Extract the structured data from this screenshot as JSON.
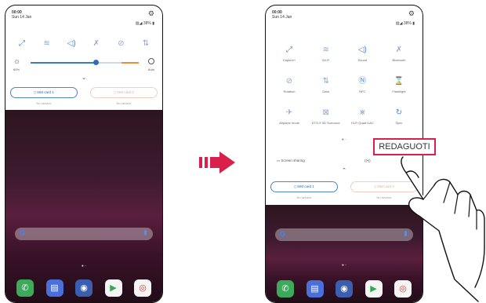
{
  "left_phone": {
    "status": {
      "time": "00:00",
      "date": "Sun 14 Jan",
      "battery": "38%"
    },
    "quick_icons": [
      "expand-icon",
      "wifi-icon",
      "sound-icon",
      "bluetooth-icon",
      "rotation-icon",
      "data-icon"
    ],
    "brightness": {
      "value_label": "60%",
      "level": 0.6,
      "auto_label": "Auto"
    },
    "sim_cards": [
      {
        "label": "SIM card 1",
        "status": "No service"
      },
      {
        "label": "SIM card 2",
        "status": "No service"
      }
    ],
    "search_logo": "G",
    "apps": [
      "phone-app",
      "messages-app",
      "camera-app",
      "play-store-app",
      "chrome-app"
    ]
  },
  "right_phone": {
    "status": {
      "time": "00:00",
      "date": "Sun 14 Jan",
      "battery": "38%"
    },
    "tiles": [
      {
        "label": "Capture+",
        "icon": "capture-icon",
        "active": true
      },
      {
        "label": "Wi-Fi",
        "icon": "wifi-icon",
        "active": false
      },
      {
        "label": "Sound",
        "icon": "sound-icon",
        "active": true
      },
      {
        "label": "Bluetooth",
        "icon": "bluetooth-icon",
        "active": false
      },
      {
        "label": "Rotation",
        "icon": "rotation-icon",
        "active": false
      },
      {
        "label": "Data",
        "icon": "data-icon",
        "active": false
      },
      {
        "label": "NFC",
        "icon": "nfc-icon",
        "active": true
      },
      {
        "label": "Flashlight",
        "icon": "flashlight-icon",
        "active": false
      },
      {
        "label": "Airplane mode",
        "icon": "airplane-icon",
        "active": false
      },
      {
        "label": "DTS:X 3D Surround",
        "icon": "dts-icon",
        "active": false
      },
      {
        "label": "Hi-Fi Quad DAC",
        "icon": "hifi-icon",
        "active": false
      },
      {
        "label": "Sync",
        "icon": "sync-icon",
        "active": true
      }
    ],
    "screen_sharing_label": "Screen sharing",
    "edit_label": "REDAGUOTI",
    "sim_cards": [
      {
        "label": "SIM card 1",
        "status": "No service"
      },
      {
        "label": "SIM card 2",
        "status": "No service"
      }
    ],
    "search_logo": "G",
    "apps": [
      "phone-app",
      "messages-app",
      "camera-app",
      "play-store-app",
      "chrome-app"
    ]
  },
  "colors": {
    "accent": "#4a86c8",
    "highlight": "#d8204a"
  }
}
